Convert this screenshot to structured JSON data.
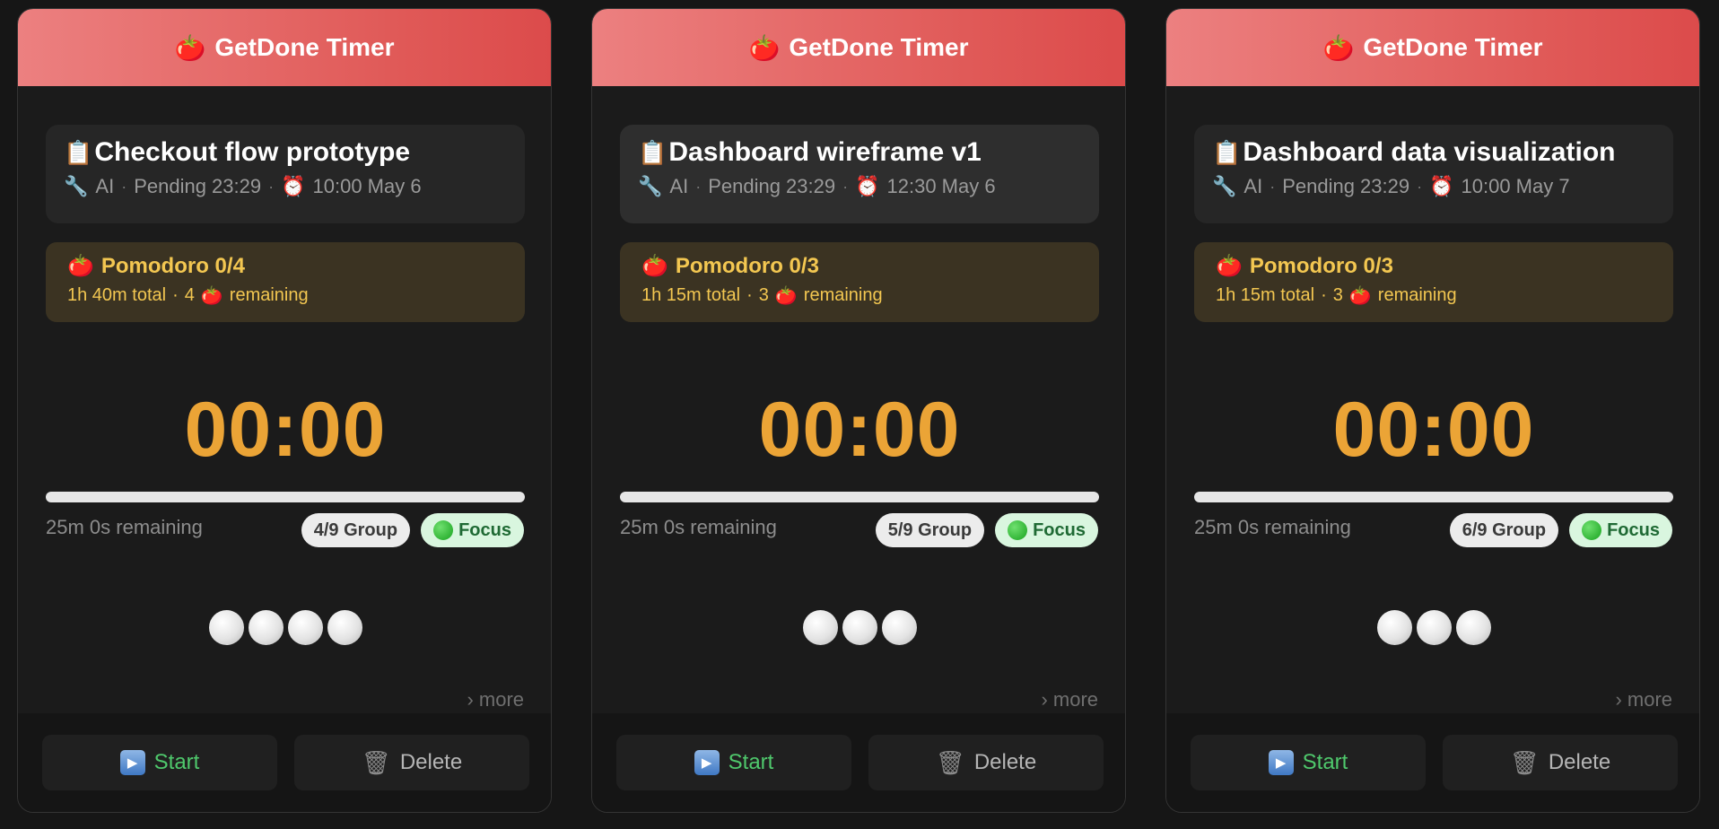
{
  "cards": [
    {
      "header": "GetDone Timer",
      "task_title": "Checkout flow prototype",
      "task_source": "AI",
      "task_status": "Pending 23:29",
      "task_due": "10:00 May 6",
      "pomo_title": "Pomodoro 0/4",
      "pomo_total": "1h 40m total",
      "pomo_remaining_count": "4",
      "pomo_remaining_label": "remaining",
      "timer": "00:00",
      "progress": 0,
      "time_remaining": "25m 0s remaining",
      "group_badge": "4/9 Group",
      "focus_badge": "Focus",
      "pomodoro_slots": 4,
      "more": "› more",
      "start_label": "Start",
      "delete_label": "Delete"
    },
    {
      "header": "GetDone Timer",
      "task_title": "Dashboard wireframe v1",
      "task_source": "AI",
      "task_status": "Pending 23:29",
      "task_due": "12:30 May 6",
      "pomo_title": "Pomodoro 0/3",
      "pomo_total": "1h 15m total",
      "pomo_remaining_count": "3",
      "pomo_remaining_label": "remaining",
      "timer": "00:00",
      "progress": 0,
      "time_remaining": "25m 0s remaining",
      "group_badge": "5/9 Group",
      "focus_badge": "Focus",
      "pomodoro_slots": 3,
      "more": "› more",
      "start_label": "Start",
      "delete_label": "Delete"
    },
    {
      "header": "GetDone Timer",
      "task_title": "Dashboard data visualization",
      "task_source": "AI",
      "task_status": "Pending 23:29",
      "task_due": "10:00 May 7",
      "pomo_title": "Pomodoro 0/3",
      "pomo_total": "1h 15m total",
      "pomo_remaining_count": "3",
      "pomo_remaining_label": "remaining",
      "timer": "00:00",
      "progress": 0,
      "time_remaining": "25m 0s remaining",
      "group_badge": "6/9 Group",
      "focus_badge": "Focus",
      "pomodoro_slots": 3,
      "more": "› more",
      "start_label": "Start",
      "delete_label": "Delete"
    }
  ],
  "icons": {
    "header": "tomato-icon",
    "task": "clipboard-icon",
    "source": "wrench-icon",
    "due": "alarm-clock-icon",
    "focus": "green-circle-icon",
    "start": "play-icon",
    "delete": "trash-icon"
  },
  "colors": {
    "header_start": "#ec8080",
    "header_end": "#dc4b4b",
    "timer": "#eba436",
    "pomo_text": "#f3c751",
    "start_text": "#4fc86c"
  }
}
